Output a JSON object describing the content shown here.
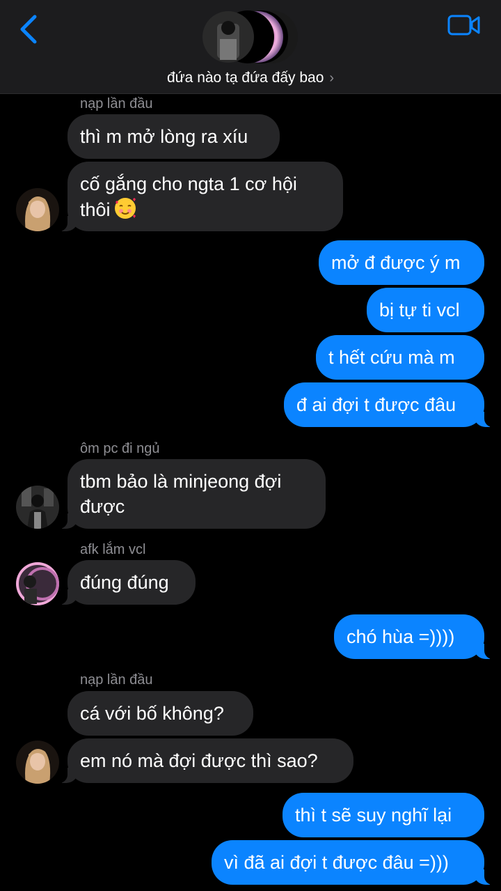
{
  "header": {
    "group_name": "đứa nào tạ đứa đấy bao",
    "chevron": "›",
    "back_icon": "chevron-left-icon",
    "video_icon": "video-camera-icon",
    "accent": "#0b84ff"
  },
  "messages": [
    {
      "sender": "nạp lần đầu",
      "text": "thì m mở lòng ra xíu"
    },
    {
      "text": "cố gắng cho ngta 1 cơ hội"
    },
    {
      "text": "thôi",
      "emoji": "smiling-face-with-hearts"
    },
    {
      "text": "mở đ được ý m"
    },
    {
      "text": "bị tự ti vcl"
    },
    {
      "text": "t hết cứu mà m"
    },
    {
      "text": "đ ai đợi t được đâu"
    },
    {
      "sender": "ôm pc đi ngủ",
      "text": "tbm bảo là minjeong đợi"
    },
    {
      "text": "được"
    },
    {
      "sender": "afk lắm vcl",
      "text": "đúng đúng"
    },
    {
      "text": "chó hùa =))))"
    },
    {
      "sender": "nạp lần đầu",
      "text": "cá với bố không?"
    },
    {
      "text": "em nó mà đợi được thì sao?"
    },
    {
      "text": "thì t sẽ suy nghĩ lại"
    },
    {
      "text": "vì đã ai đợi t được đâu =)))"
    }
  ],
  "colors": {
    "incoming_bubble": "#262628",
    "outgoing_bubble": "#0b84ff",
    "background": "#000000",
    "header": "#1c1c1e"
  }
}
